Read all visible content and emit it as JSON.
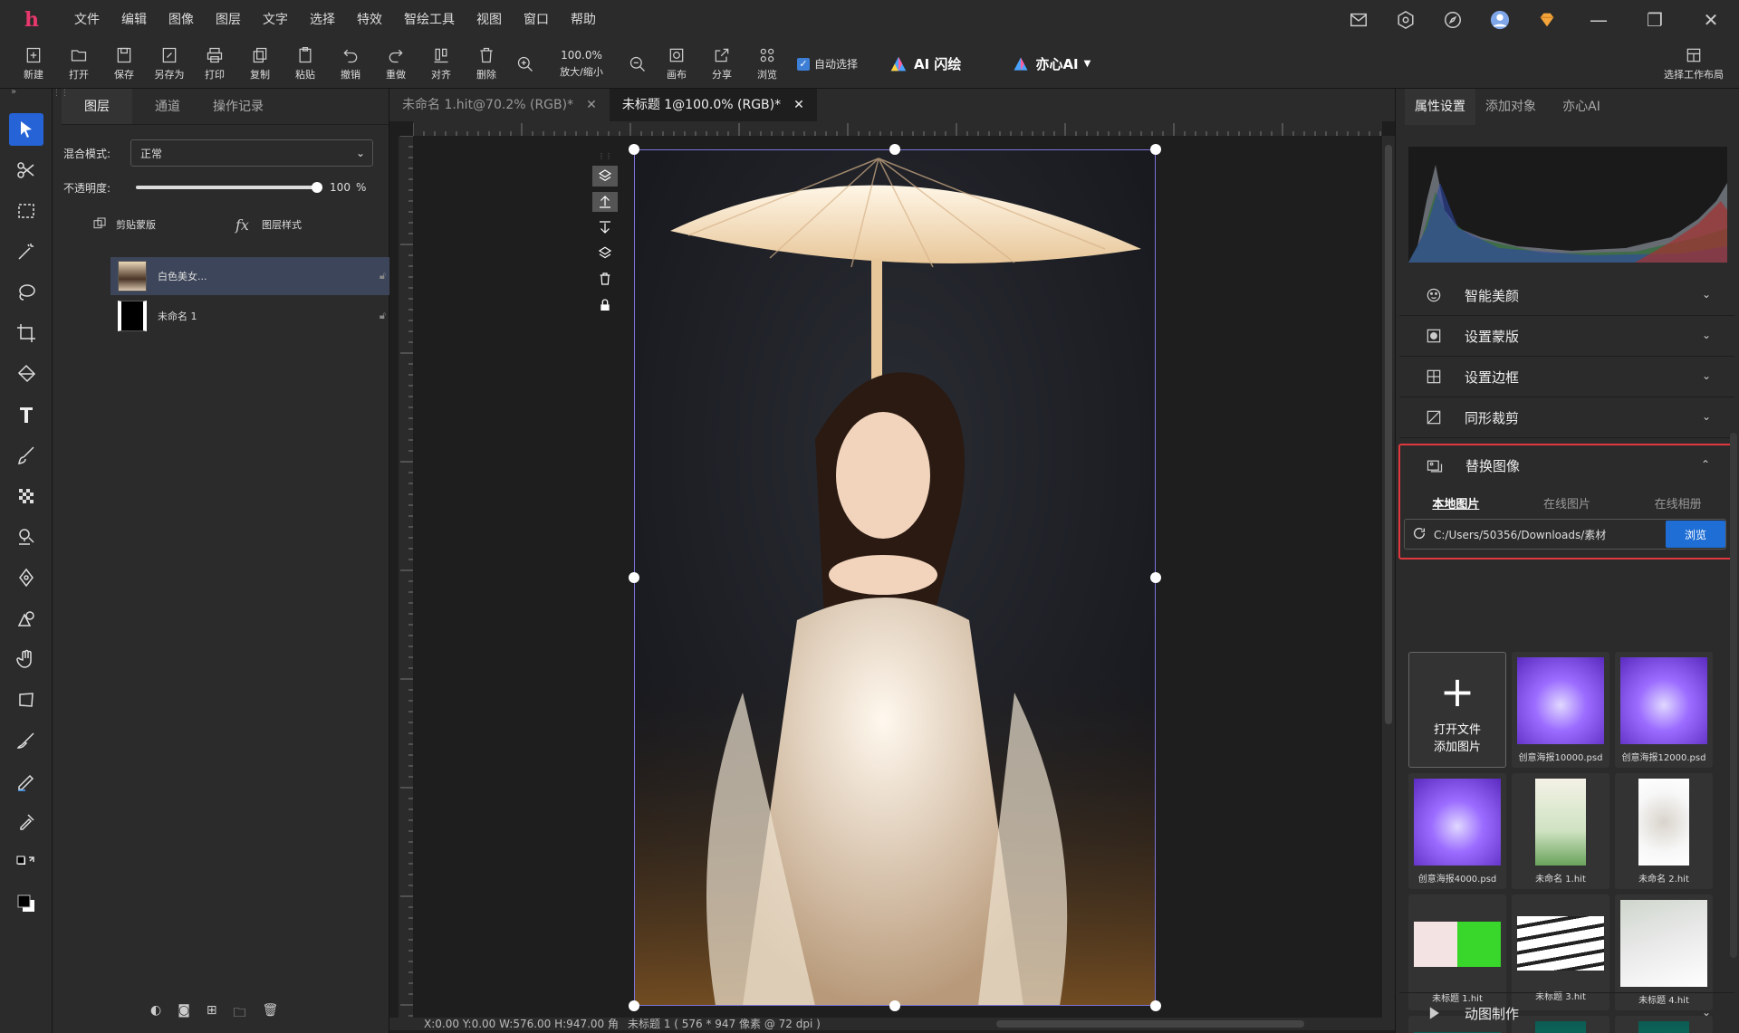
{
  "menu": [
    "文件",
    "编辑",
    "图像",
    "图层",
    "文字",
    "选择",
    "特效",
    "智绘工具",
    "视图",
    "窗口",
    "帮助"
  ],
  "toolbar": {
    "new": "新建",
    "open": "打开",
    "save": "保存",
    "save_as": "另存为",
    "print": "打印",
    "copy": "复制",
    "paste": "粘贴",
    "undo": "撤销",
    "redo": "重做",
    "align": "对齐",
    "delete": "删除",
    "zoom_value": "100.0%",
    "zoom_label": "放大/缩小",
    "canvas": "画布",
    "share": "分享",
    "browse": "浏览",
    "auto_select": "自动选择",
    "ai_flash": "AI 闪绘",
    "yixin_ai": "亦心AI",
    "workspace": "选择工作布局"
  },
  "layers_panel": {
    "tabs": [
      "图层",
      "通道",
      "操作记录"
    ],
    "blend_label": "混合模式:",
    "blend_value": "正常",
    "opacity_label": "不透明度:",
    "opacity_value": "100",
    "opacity_unit": "%",
    "opacity_level": 1.0,
    "clip_mask": "剪贴蒙版",
    "layer_style": "图层样式",
    "layers": [
      {
        "name": "白色美女..."
      },
      {
        "name": "未命名 1"
      }
    ]
  },
  "doc_tabs": [
    "未命名 1.hit@70.2% (RGB)*",
    "未标题 1@100.0% (RGB)*"
  ],
  "status": {
    "coords": "X:0.00 Y:0.00 W:576.00 H:947.00 角",
    "doc": "未标题 1 ( 576 * 947 像素 @ 72 dpi )"
  },
  "right_panel": {
    "tabs": [
      "属性设置",
      "添加对象",
      "亦心AI"
    ],
    "sections": [
      "智能美颜",
      "设置蒙版",
      "设置边框",
      "同形裁剪",
      "替换图像"
    ],
    "subtabs": [
      "本地图片",
      "在线图片",
      "在线相册"
    ],
    "path": "C:/Users/50356/Downloads/素材",
    "browse": "浏览",
    "add_line1": "打开文件",
    "add_line2": "添加图片",
    "files": [
      "创意海报10000.psd",
      "创意海报12000.psd",
      "创意海报4000.psd",
      "未命名 1.hit",
      "未命名 2.hit",
      "未标题 1.hit",
      "未标题 3.hit",
      "未标题 4.hit"
    ],
    "bottom_section": "动图制作"
  },
  "colors": {
    "accent": "#1e6ed6",
    "highlight": "#e0383e",
    "logo": "#e8386d"
  }
}
